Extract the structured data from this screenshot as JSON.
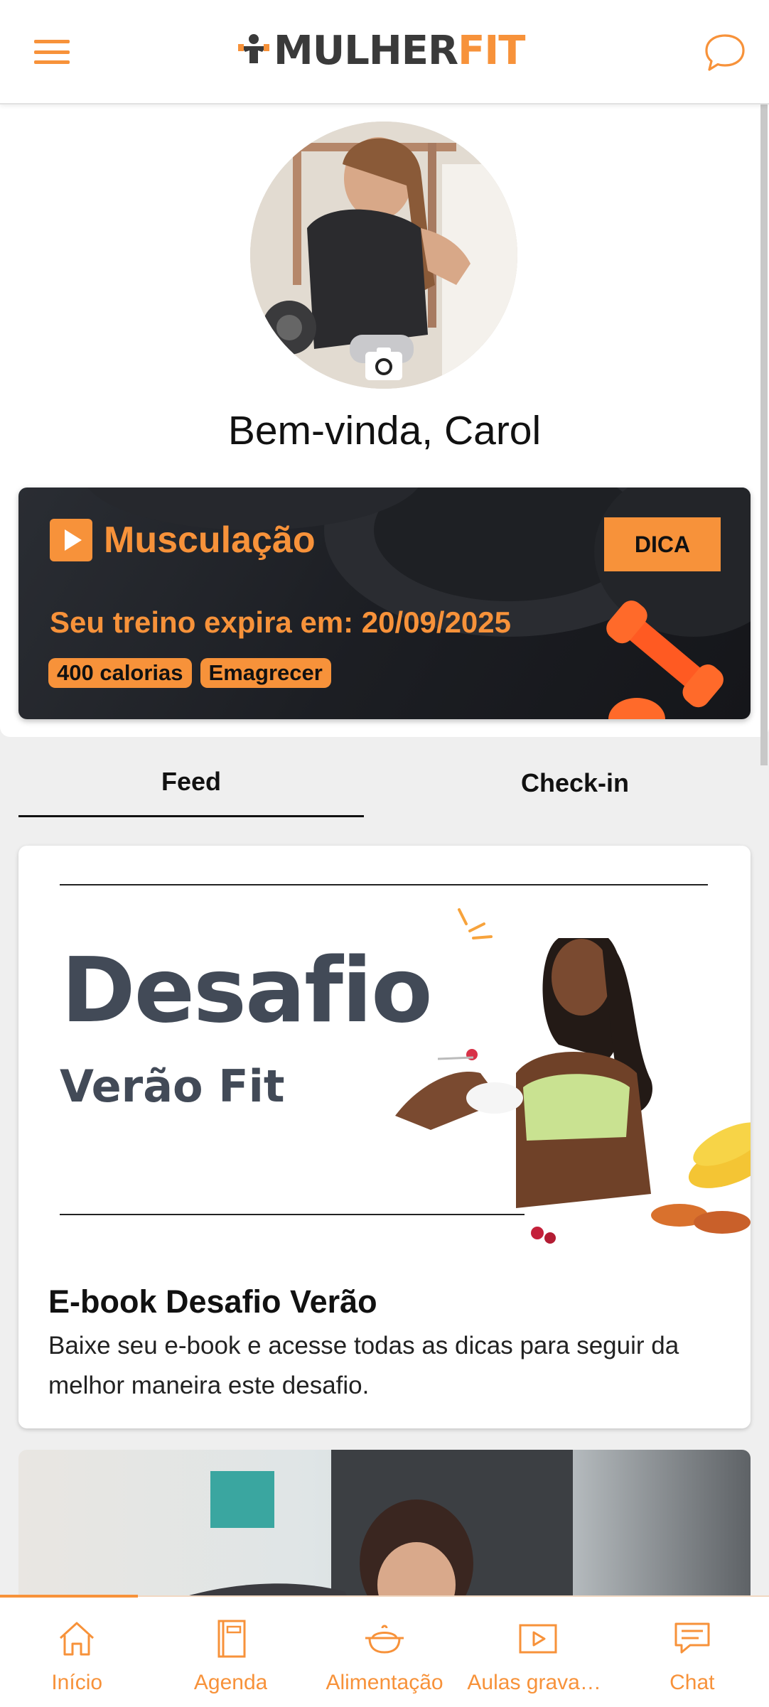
{
  "header": {
    "menu_icon": "hamburger-menu-icon",
    "logo_part1": "MULHER",
    "logo_part2": "FIT",
    "chat_icon": "chat-bubble-icon"
  },
  "profile": {
    "camera_icon": "camera-icon",
    "welcome": "Bem-vinda, Carol"
  },
  "workout": {
    "title": "Musculação",
    "button": "DICA",
    "expire": "Seu treino expira em: 20/09/2025",
    "tags": [
      "400 calorias",
      "Emagrecer"
    ]
  },
  "tabs": [
    {
      "label": "Feed",
      "active": true
    },
    {
      "label": "Check-in",
      "active": false
    }
  ],
  "feed": [
    {
      "image_heading": "Desafio",
      "image_subheading": "Verão Fit",
      "title": "E-book Desafio Verão",
      "description": "Baixe seu e-book e acesse todas as dicas para seguir da melhor maneira este desafio."
    }
  ],
  "bottom_nav": [
    {
      "label": "Início",
      "icon": "home-icon"
    },
    {
      "label": "Agenda",
      "icon": "notebook-icon"
    },
    {
      "label": "Alimentação",
      "icon": "food-pot-icon"
    },
    {
      "label": "Aulas gravad...",
      "icon": "video-play-icon"
    },
    {
      "label": "Chat",
      "icon": "chat-icon"
    }
  ],
  "colors": {
    "accent": "#f7923a",
    "logo_dark": "#3a3a3a",
    "heading_gray": "#424a57",
    "background": "#efefef"
  }
}
